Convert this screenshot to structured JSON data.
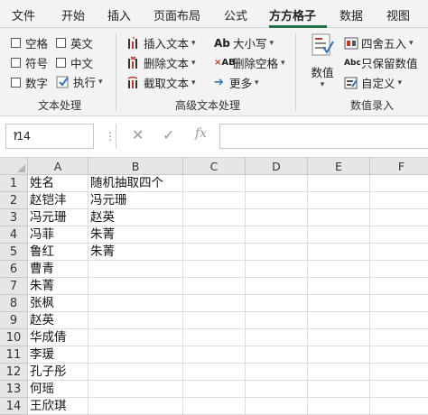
{
  "tabs": [
    "文件",
    "开始",
    "插入",
    "页面布局",
    "公式",
    "方方格子",
    "数据",
    "视图"
  ],
  "active_tab": "方方格子",
  "ribbon": {
    "text_group": {
      "checkboxes": [
        "空格",
        "英文",
        "符号",
        "中文",
        "数字"
      ],
      "execute": "执行",
      "label": "文本处理"
    },
    "advanced_group": {
      "insert_text": "插入文本",
      "delete_text": "删除文本",
      "extract_text": "截取文本",
      "case": "大小写",
      "delete_spaces": "删除空格",
      "more": "更多",
      "label": "高级文本处理"
    },
    "number_group": {
      "value": "数值",
      "round": "四舍五入",
      "keep_value": "只保留数值",
      "custom": "自定义",
      "label": "数值录入"
    }
  },
  "formula_bar": {
    "name_box": "I14",
    "formula": ""
  },
  "sheet": {
    "columns": [
      "A",
      "B",
      "C",
      "D",
      "E",
      "F"
    ],
    "rows": [
      {
        "num": "1",
        "a": "姓名",
        "b": "随机抽取四个"
      },
      {
        "num": "2",
        "a": "赵铠沣",
        "b": "冯元珊"
      },
      {
        "num": "3",
        "a": "冯元珊",
        "b": "赵英"
      },
      {
        "num": "4",
        "a": "冯菲",
        "b": "朱菁"
      },
      {
        "num": "5",
        "a": "鲁红",
        "b": "朱菁"
      },
      {
        "num": "6",
        "a": "曹青",
        "b": ""
      },
      {
        "num": "7",
        "a": "朱菁",
        "b": ""
      },
      {
        "num": "8",
        "a": "张枫",
        "b": ""
      },
      {
        "num": "9",
        "a": "赵英",
        "b": ""
      },
      {
        "num": "10",
        "a": "华成倩",
        "b": ""
      },
      {
        "num": "11",
        "a": "李瑗",
        "b": ""
      },
      {
        "num": "12",
        "a": "孔子彤",
        "b": ""
      },
      {
        "num": "13",
        "a": "何瑶",
        "b": ""
      },
      {
        "num": "14",
        "a": "王欣琪",
        "b": ""
      }
    ]
  },
  "colors": {
    "accent": "#217346",
    "red_icon": "#c0392b",
    "blue_icon": "#2e75b6"
  }
}
